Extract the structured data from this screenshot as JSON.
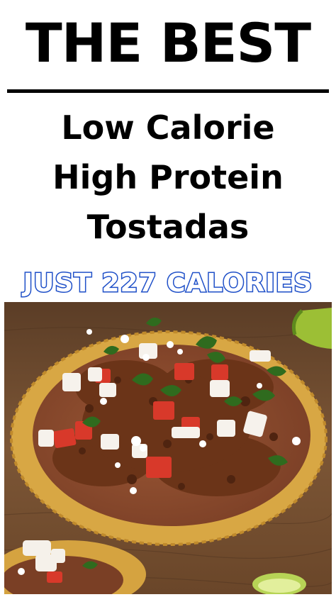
{
  "headline": "THE BEST",
  "subtitle": {
    "line1": "Low Calorie",
    "line2": "High Protein",
    "line3": "Tostadas"
  },
  "calories_banner": "JUST 227 CALORIES",
  "colors": {
    "banner_blue": "#1e4fc8",
    "text_black": "#000000",
    "board_wood": "#7a5533",
    "tostada_shell": "#d8a744",
    "bean_spread": "#8a4a2e",
    "lime": "#a9c93a"
  }
}
